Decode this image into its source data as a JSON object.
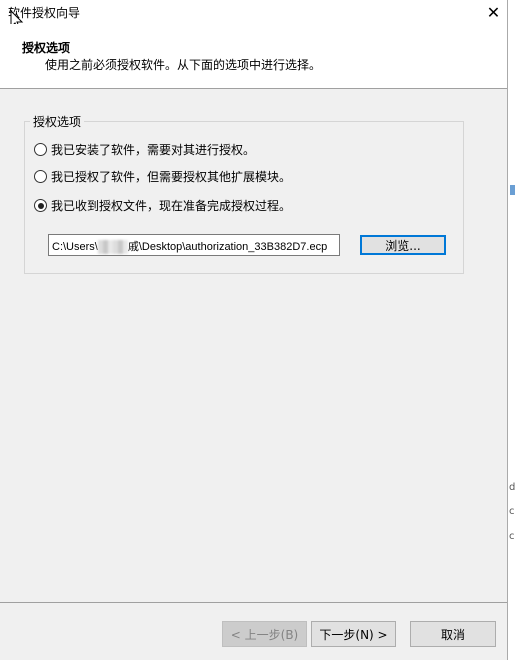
{
  "window": {
    "title": "软件授权向导",
    "close_label": "✕"
  },
  "header": {
    "heading": "授权选项",
    "subtitle": "使用之前必须授权软件。从下面的选项中进行选择。"
  },
  "options_group": {
    "legend": "授权选项",
    "options": [
      {
        "label": "我已安装了软件，需要对其进行授权。",
        "selected": false
      },
      {
        "label": "我已授权了软件，但需要授权其他扩展模块。",
        "selected": false
      },
      {
        "label": "我已收到授权文件，现在准备完成授权过程。",
        "selected": true
      }
    ],
    "file_path_prefix": "C:\\Users\\",
    "file_path_mid": "戚",
    "file_path_suffix": "\\Desktop\\authorization_33B382D7.ecp",
    "browse_label": "浏览..."
  },
  "footer": {
    "back_label": "< 上一步(B)",
    "next_label": "下一步(N) >",
    "cancel_label": "取消"
  },
  "right_strip": {
    "glyph1": "d",
    "glyph2": "c",
    "glyph3": "c"
  }
}
